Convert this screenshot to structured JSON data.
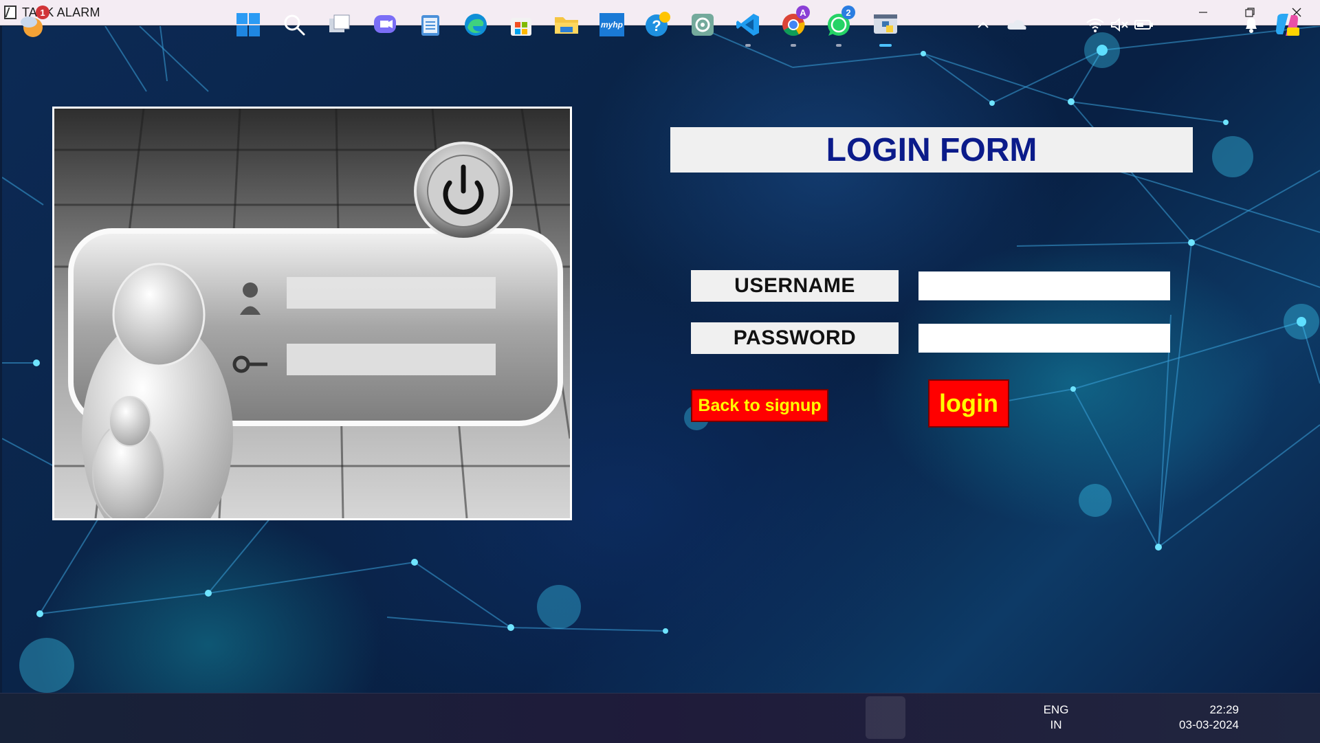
{
  "window": {
    "title": "TASK ALARM",
    "controls": {
      "minimize": "—",
      "maximize": "❐",
      "close": "✕"
    }
  },
  "form": {
    "title": "LOGIN FORM",
    "username_label": "USERNAME",
    "password_label": "PASSWORD",
    "username_value": "",
    "password_value": "",
    "back_button": "Back to signup",
    "login_button": "login"
  },
  "taskbar": {
    "weather_badge": "1",
    "chrome_badge": "A",
    "whatsapp_badge": "2",
    "myhp_label": "myhp",
    "language_top": "ENG",
    "language_bottom": "IN",
    "time": "22:29",
    "date": "03-03-2024"
  },
  "colors": {
    "title_text": "#0b1b8a",
    "button_bg": "#ff0000",
    "button_text": "#ffff00",
    "label_bg": "#f0f0f0"
  }
}
